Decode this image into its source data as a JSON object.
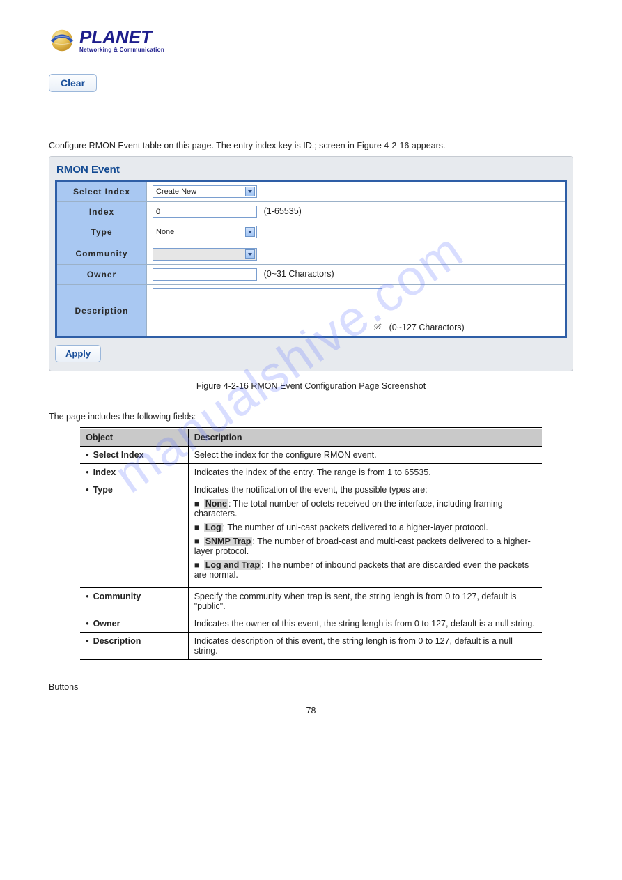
{
  "logo": {
    "brand": "PLANET",
    "tagline": "Networking & Communication"
  },
  "clear_button": "Clear",
  "lead": "Configure RMON Event table on this page. The entry index key is ID.; screen in Figure 4-2-16 appears.",
  "panel": {
    "title": "RMON Event",
    "rows": {
      "select_index": {
        "label": "Select Index",
        "value": "Create New"
      },
      "index": {
        "label": "Index",
        "value": "0",
        "hint": "(1-65535)"
      },
      "type": {
        "label": "Type",
        "value": "None"
      },
      "community": {
        "label": "Community",
        "value": ""
      },
      "owner": {
        "label": "Owner",
        "value": "",
        "hint": "(0~31 Charactors)"
      },
      "description": {
        "label": "Description",
        "value": "",
        "hint": "(0~127 Charactors)"
      }
    },
    "apply": "Apply"
  },
  "figure_caption": "Figure 4-2-16 RMON Event Configuration Page Screenshot",
  "page_intro": "The page includes the following fields:",
  "table": {
    "head_obj": "Object",
    "head_desc": "Description",
    "rows": [
      {
        "obj": "Select Index",
        "desc": "Select the index for the configure RMON event."
      },
      {
        "obj": "Index",
        "desc": "Indicates the index of the entry. The range is from 1 to 65535."
      },
      {
        "obj": "Type",
        "desc_intro": "Indicates the notification of the event, the possible types are:",
        "items": [
          {
            "k": "None",
            "v": ": The total number of octets received on the interface, including framing characters."
          },
          {
            "k": "Log",
            "v": ": The number of uni-cast packets delivered to a higher-layer protocol."
          },
          {
            "k": "SNMP Trap",
            "v": ": The number of broad-cast and multi-cast packets delivered to a higher-layer protocol."
          },
          {
            "k": "Log and Trap",
            "v": ": The number of inbound packets that are discarded even the packets are normal."
          }
        ]
      },
      {
        "obj": "Community",
        "desc": "Specify the community when trap is sent, the string lengh is from 0 to 127, default is \"public\"."
      },
      {
        "obj": "Owner",
        "desc": "Indicates the owner of this event, the string lengh is from 0 to 127, default is a null string."
      },
      {
        "obj": "Description",
        "desc": "Indicates description of this event, the string lengh is from 0 to 127, default is a null string."
      }
    ]
  },
  "buttons_title": "Buttons",
  "footer_page": "78",
  "watermark": "manualshive.com"
}
